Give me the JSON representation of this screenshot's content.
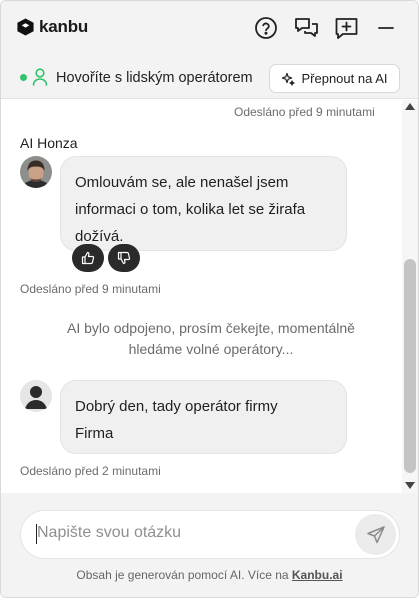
{
  "header": {
    "brand": "kanbu",
    "icons": [
      "help-icon",
      "conversations-icon",
      "new-chat-icon",
      "minimize-icon"
    ]
  },
  "status": {
    "text": "Hovoříte s lidským operátorem",
    "switch_label": "Přepnout na AI",
    "dot_color": "#33c36a"
  },
  "messages": {
    "top_meta": "Odesláno před 9 minutami",
    "ai": {
      "sender": "AI Honza",
      "lines": [
        "Omlouvám se, ale nenašel jsem",
        "informaci o tom, kolika let se žirafa",
        "dožívá."
      ],
      "meta": "Odesláno před 9 minutami"
    },
    "system": {
      "lines": [
        "AI bylo odpojeno, prosím čekejte, momentálně",
        "hledáme volné operátory..."
      ]
    },
    "operator": {
      "lines": [
        "Dobrý den, tady operátor firmy",
        "Firma"
      ],
      "meta": "Odesláno před 2 minutami"
    }
  },
  "composer": {
    "placeholder": "Napište svou otázku"
  },
  "footer": {
    "disclaimer_prefix": "Obsah je generován pomocí AI. Více na ",
    "link": "Kanbu.ai"
  }
}
